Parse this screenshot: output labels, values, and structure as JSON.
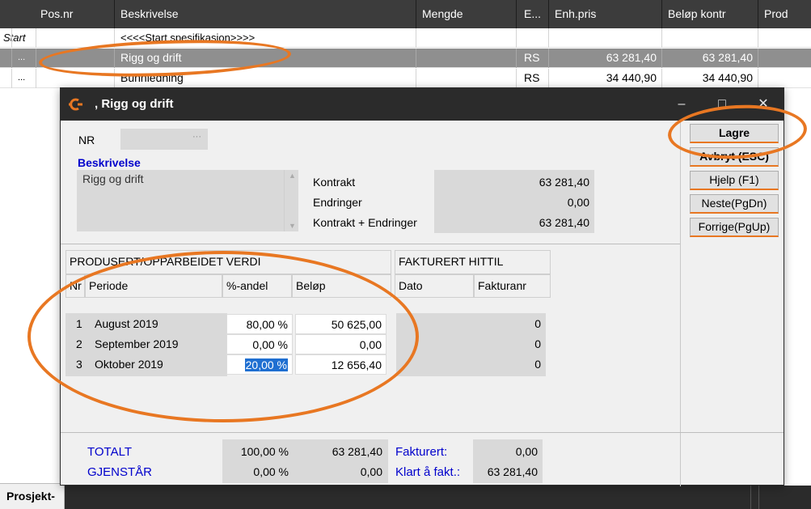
{
  "grid": {
    "columns": [
      "Pos.nr",
      "Beskrivelse",
      "Mengde",
      "E...",
      "Enh.pris",
      "Beløp kontr",
      "Prod"
    ],
    "rows": [
      {
        "marker": "Start",
        "pos": "",
        "desc": "<<<<Start spesifikasjon>>>>",
        "unit": "",
        "price": "",
        "amount": ""
      },
      {
        "marker": "...",
        "pos": "",
        "desc": "Rigg og drift",
        "unit": "RS",
        "price": "63 281,40",
        "amount": "63 281,40"
      },
      {
        "marker": "...",
        "pos": "",
        "desc": "Bunnledning",
        "unit": "RS",
        "price": "34 440,90",
        "amount": "34 440,90"
      }
    ],
    "bottom_tab": "Prosjekt-"
  },
  "dialog": {
    "title": ", Rigg og drift",
    "nr_label": "NR",
    "nr_dots": "···",
    "description_label": "Beskrivelse",
    "description_value": "Rigg og drift",
    "contract": {
      "kontrakt_label": "Kontrakt",
      "kontrakt_value": "63 281,40",
      "endringer_label": "Endringer",
      "endringer_value": "0,00",
      "sum_label": "Kontrakt + Endringer",
      "sum_value": "63 281,40"
    },
    "buttons": {
      "save": "Lagre",
      "cancel": "Avbryt (ESC)",
      "help": "Hjelp (F1)",
      "next": "Neste(PgDn)",
      "prev": "Forrige(PgUp)"
    },
    "produced": {
      "section_title": "PRODUSERT/OPPARBEIDET VERDI",
      "columns": [
        "Nr",
        "Periode",
        "%-andel",
        "Beløp"
      ],
      "rows": [
        {
          "nr": "1",
          "period": "August 2019",
          "pct": "80,00 %",
          "amount": "50 625,00"
        },
        {
          "nr": "2",
          "period": "September 2019",
          "pct": "0,00 %",
          "amount": "0,00"
        },
        {
          "nr": "3",
          "period": "Oktober 2019",
          "pct": "20,00 %",
          "amount": "12 656,40"
        }
      ]
    },
    "invoiced": {
      "section_title": "FAKTURERT HITTIL",
      "columns": [
        "Dato",
        "Fakturanr"
      ],
      "rows": [
        {
          "value": "0"
        },
        {
          "value": "0"
        },
        {
          "value": "0"
        }
      ]
    },
    "totals": {
      "total_label": "TOTALT",
      "total_pct": "100,00 %",
      "total_amount": "63 281,40",
      "remaining_label": "GJENSTÅR",
      "remaining_pct": "0,00 %",
      "remaining_amount": "0,00",
      "invoiced_label": "Fakturert:",
      "invoiced_value": "0,00",
      "ready_label": "Klart å fakt.:",
      "ready_value": "63 281,40"
    }
  },
  "colors": {
    "accent": "#e87722",
    "selection": "#1f6fd1",
    "blue_text": "#0000cc"
  }
}
